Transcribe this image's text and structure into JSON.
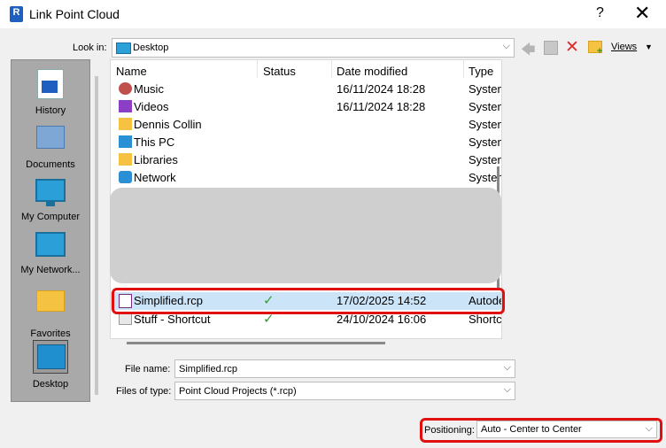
{
  "window": {
    "title": "Link Point Cloud",
    "help": "?",
    "close": "✕",
    "app_icon_letter": "R"
  },
  "toolbar": {
    "look_in_label": "Look in:",
    "look_in_value": "Desktop",
    "views_label": "Views"
  },
  "places": [
    {
      "label": "History",
      "icon": "history-icon"
    },
    {
      "label": "Documents",
      "icon": "documents-icon"
    },
    {
      "label": "My Computer",
      "icon": "computer-icon"
    },
    {
      "label": "My Network...",
      "icon": "network-places-icon"
    },
    {
      "label": "Favorites",
      "icon": "favorites-folder-icon"
    },
    {
      "label": "Desktop",
      "icon": "desktop-icon"
    }
  ],
  "columns": {
    "name": "Name",
    "status": "Status",
    "date": "Date modified",
    "type": "Type"
  },
  "files": [
    {
      "name": "Music",
      "status": "",
      "date": "16/11/2024 18:28",
      "type": "System",
      "icon": "music-icon",
      "color": "#c0504d"
    },
    {
      "name": "Videos",
      "status": "",
      "date": "16/11/2024 18:28",
      "type": "System",
      "icon": "videos-icon",
      "color": "#8a3fc4"
    },
    {
      "name": "Dennis Collin",
      "status": "",
      "date": "",
      "type": "System",
      "icon": "folder-icon",
      "color": "#f5c242"
    },
    {
      "name": "This PC",
      "status": "",
      "date": "",
      "type": "System",
      "icon": "pc-icon",
      "color": "#2b8fd6"
    },
    {
      "name": "Libraries",
      "status": "",
      "date": "",
      "type": "System",
      "icon": "libraries-icon",
      "color": "#f5c242"
    },
    {
      "name": "Network",
      "status": "",
      "date": "",
      "type": "System",
      "icon": "network-icon",
      "color": "#2b8fd6"
    }
  ],
  "selected_file": {
    "name": "Simplified.rcp",
    "status": "✓",
    "date": "17/02/2025 14:52",
    "type": "Autodesk",
    "icon": "rcp-file-icon"
  },
  "shortcut_file": {
    "name": "Stuff - Shortcut",
    "status": "✓",
    "date": "24/10/2024 16:06",
    "type": "Shortcut",
    "icon": "shortcut-icon"
  },
  "form": {
    "file_name_label": "File name:",
    "file_name_value": "Simplified.rcp",
    "file_type_label": "Files of type:",
    "file_type_value": "Point Cloud Projects (*.rcp)",
    "positioning_label": "Positioning:",
    "positioning_value": "Auto - Center to Center"
  },
  "colors": {
    "highlight": "#e01010",
    "selection": "#cce4f7",
    "status_ok": "#3a9a3a"
  }
}
